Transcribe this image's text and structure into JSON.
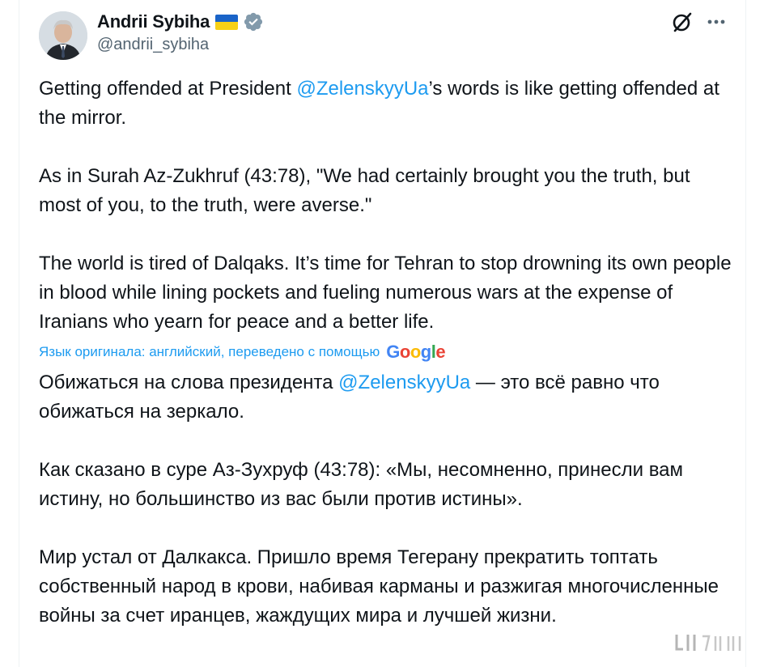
{
  "author": {
    "display_name": "Andrii Sybiha",
    "handle": "@andrii_sybiha",
    "flag_icon": "ukraine-flag-icon",
    "verified_icon": "verified-badge-icon",
    "verified_color": "#829aab"
  },
  "header_actions": {
    "grok_icon": "grok-icon",
    "more_icon": "more-options-icon"
  },
  "tweet": {
    "original": {
      "p1_before": "Getting offended at President ",
      "p1_mention": "@ZelenskyyUa",
      "p1_after": "’s words is like getting offended at the mirror.",
      "p2": "As in Surah Az-Zukhruf (43:78), \"We had certainly brought you the truth, but most of you, to the truth, were averse.\"",
      "p3": "The world is tired of Dalqaks. It’s time for Tehran to stop drowning its own people in blood while lining pockets and fueling numerous wars at the expense of Iranians who yearn for peace and a better life."
    },
    "translation_note": "Язык оригинала: английский, переведено с помощью",
    "translation_provider": "Google",
    "translated": {
      "p1_before": "Обижаться на слова президента ",
      "p1_mention": "@ZelenskyyUa",
      "p1_after": " — это всё равно что обижаться на зеркало.",
      "p2": "Как сказано в суре Аз-Зухруф (43:78): «Мы, несомненно, принесли вам истину, но большинство из вас были против истины».",
      "p3": "Мир устал от Далкакса. Пришло время Тегерану прекратить топтать собственный народ в крови, набивая карманы и разжигая многочисленные войны за счет иранцев, жаждущих мира и лучшей жизни."
    }
  },
  "colors": {
    "text": "#0f1419",
    "secondary": "#536471",
    "link": "#1d9bf0"
  }
}
